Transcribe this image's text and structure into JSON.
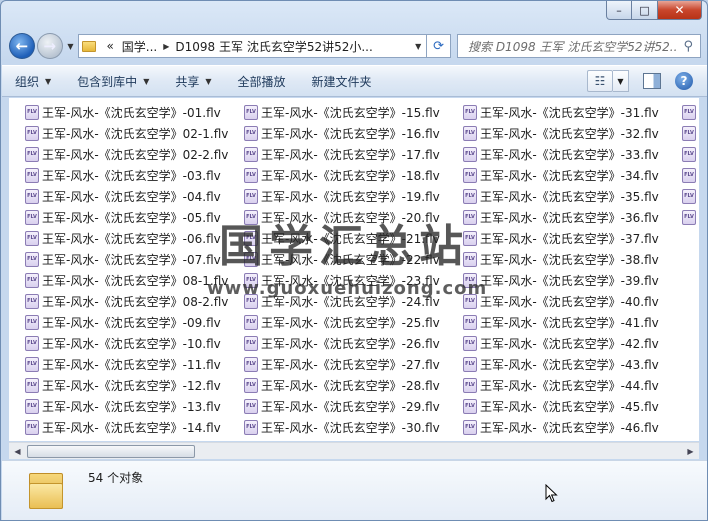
{
  "window": {
    "close_label": "✕",
    "max_label": "□",
    "min_label": "–"
  },
  "nav": {
    "back_label": "←",
    "forward_label": "→",
    "crumbs": [
      "«",
      "国学...",
      "D1098 王军 沈氏玄空学52讲52小..."
    ],
    "search_placeholder": "搜索 D1098 王军 沈氏玄空学52讲52...",
    "refresh_label": "⟳"
  },
  "toolbar": {
    "organize": "组织",
    "include_library": "包含到库中",
    "share": "共享",
    "play_all": "全部播放",
    "new_folder": "新建文件夹"
  },
  "icons": {
    "file": "FLV"
  },
  "files": {
    "col1": [
      "王军-风水-《沈氏玄空学》-01.flv",
      "王军-风水-《沈氏玄空学》02-1.flv",
      "王军-风水-《沈氏玄空学》02-2.flv",
      "王军-风水-《沈氏玄空学》-03.flv",
      "王军-风水-《沈氏玄空学》-04.flv",
      "王军-风水-《沈氏玄空学》-05.flv",
      "王军-风水-《沈氏玄空学》-06.flv",
      "王军-风水-《沈氏玄空学》-07.flv",
      "王军-风水-《沈氏玄空学》08-1.flv",
      "王军-风水-《沈氏玄空学》08-2.flv",
      "王军-风水-《沈氏玄空学》-09.flv",
      "王军-风水-《沈氏玄空学》-10.flv",
      "王军-风水-《沈氏玄空学》-11.flv",
      "王军-风水-《沈氏玄空学》-12.flv",
      "王军-风水-《沈氏玄空学》-13.flv",
      "王军-风水-《沈氏玄空学》-14.flv"
    ],
    "col2": [
      "王军-风水-《沈氏玄空学》-15.flv",
      "王军-风水-《沈氏玄空学》-16.flv",
      "王军-风水-《沈氏玄空学》-17.flv",
      "王军-风水-《沈氏玄空学》-18.flv",
      "王军-风水-《沈氏玄空学》-19.flv",
      "王军-风水-《沈氏玄空学》-20.flv",
      "王军-风水-《沈氏玄空学》-21.flv",
      "王军-风水-《沈氏玄空学》-22.flv",
      "王军-风水-《沈氏玄空学》-23.flv",
      "王军-风水-《沈氏玄空学》-24.flv",
      "王军-风水-《沈氏玄空学》-25.flv",
      "王军-风水-《沈氏玄空学》-26.flv",
      "王军-风水-《沈氏玄空学》-27.flv",
      "王军-风水-《沈氏玄空学》-28.flv",
      "王军-风水-《沈氏玄空学》-29.flv",
      "王军-风水-《沈氏玄空学》-30.flv"
    ],
    "col3": [
      "王军-风水-《沈氏玄空学》-31.flv",
      "王军-风水-《沈氏玄空学》-32.flv",
      "王军-风水-《沈氏玄空学》-33.flv",
      "王军-风水-《沈氏玄空学》-34.flv",
      "王军-风水-《沈氏玄空学》-35.flv",
      "王军-风水-《沈氏玄空学》-36.flv",
      "王军-风水-《沈氏玄空学》-37.flv",
      "王军-风水-《沈氏玄空学》-38.flv",
      "王军-风水-《沈氏玄空学》-39.flv",
      "王军-风水-《沈氏玄空学》-40.flv",
      "王军-风水-《沈氏玄空学》-41.flv",
      "王军-风水-《沈氏玄空学》-42.flv",
      "王军-风水-《沈氏玄空学》-43.flv",
      "王军-风水-《沈氏玄空学》-44.flv",
      "王军-风水-《沈氏玄空学》-45.flv",
      "王军-风水-《沈氏玄空学》-46.flv"
    ],
    "col4_count": 6
  },
  "watermark": {
    "title": "国学汇总站",
    "url": "www.guoxuehuizong.com"
  },
  "status": {
    "count": "54 个对象"
  }
}
